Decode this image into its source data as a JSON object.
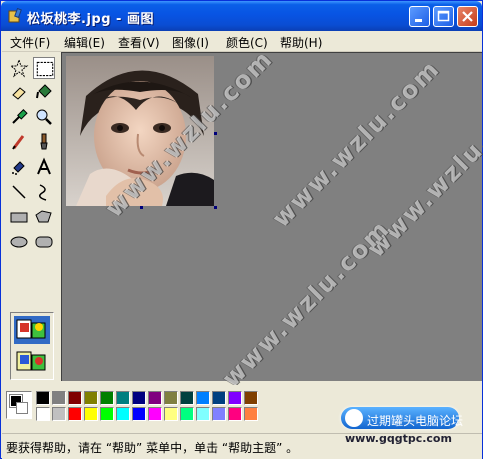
{
  "window": {
    "title": "松坂桃李.jpg - 画图"
  },
  "menu": [
    {
      "label": "文件(F)",
      "icon": ""
    },
    {
      "label": "编辑(E)",
      "icon": ""
    },
    {
      "label": "查看(V)",
      "icon": ""
    },
    {
      "label": "图像(I)",
      "icon": ""
    },
    {
      "label": "颜色(C)",
      "icon": ""
    },
    {
      "label": "帮助(H)",
      "icon": ""
    }
  ],
  "tools": [
    "free-form-select-icon",
    "select-icon",
    "eraser-icon",
    "fill-bucket-icon",
    "pick-color-icon",
    "magnifier-icon",
    "pencil-icon",
    "brush-icon",
    "airbrush-icon",
    "text-icon",
    "line-icon",
    "curve-icon",
    "rectangle-icon",
    "polygon-icon",
    "ellipse-icon",
    "rounded-rectangle-icon"
  ],
  "options": {
    "selected": "opaque"
  },
  "palette": {
    "foreground": "#000000",
    "background": "#ffffff",
    "top_row": [
      "#000000",
      "#808080",
      "#800000",
      "#808000",
      "#008000",
      "#008080",
      "#000080",
      "#800080",
      "#808040",
      "#004040",
      "#0080ff",
      "#004080",
      "#8000ff",
      "#804000"
    ],
    "bottom_row": [
      "#ffffff",
      "#c0c0c0",
      "#ff0000",
      "#ffff00",
      "#00ff00",
      "#00ffff",
      "#0000ff",
      "#ff00ff",
      "#ffff80",
      "#00ff80",
      "#80ffff",
      "#8080ff",
      "#ff0080",
      "#ff8040"
    ]
  },
  "status": {
    "text": "要获得帮助，请在 “帮助” 菜单中，单击 “帮助主题” 。"
  },
  "watermark": "www.wzlu.com",
  "logo": {
    "name": "过期罐头电脑论坛",
    "url": "www.gqgtpc.com"
  },
  "colors": {
    "titlebar": "#0a4dd3",
    "canvas_bg": "#808080",
    "chrome": "#ece9d8"
  }
}
